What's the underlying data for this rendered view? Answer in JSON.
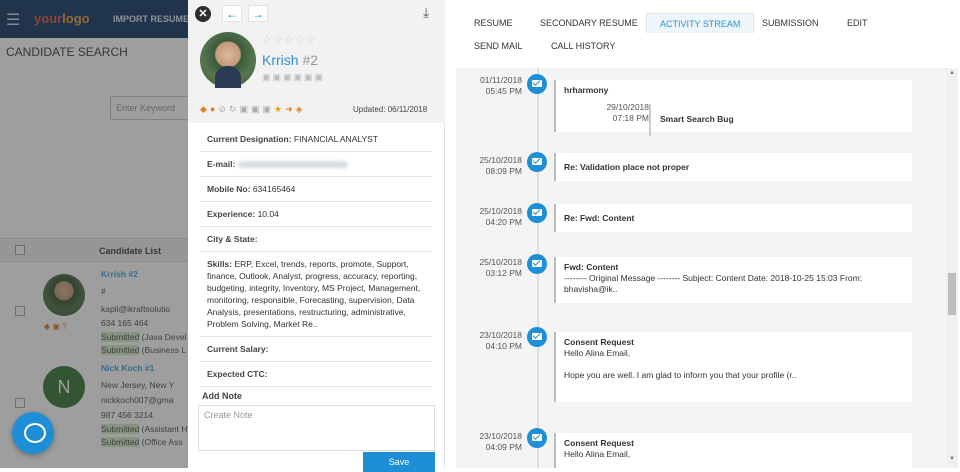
{
  "background": {
    "logo": {
      "part1": "your",
      "part2": "logo"
    },
    "import_resume": "IMPORT RESUME",
    "page_title": "CANDIDATE SEARCH",
    "keyword_placeholder": "Enter Keyword",
    "list_header": "Candidate List",
    "candidates": [
      {
        "name": "Krrish #2",
        "line2": "#",
        "email": "kapil@ikraftsolutio",
        "phone": "634 165 464",
        "status1": "Submitted",
        "status1_rest": " (Java Devel",
        "status2": "Submitted",
        "status2_rest": " (Business L"
      },
      {
        "name": "Nick Koch #1",
        "initial": "N",
        "address": "New Jersey, New Y",
        "email": "nickkoch007@gma",
        "phone": "987 456 3214",
        "status1": "Submitted",
        "status1_rest": " (Assistant H",
        "status2": "Submitted",
        "status2_rest": " (Office Ass"
      }
    ]
  },
  "profile": {
    "name": "Krrish",
    "number": "#2",
    "rating_stars": "☆☆☆☆☆",
    "updated_label": "Updated:",
    "updated_date": "06/11/2018",
    "fields": {
      "designation_label": "Current Designation:",
      "designation_value": "FINANCIAL ANALYST",
      "email_label": "E-mail:",
      "mobile_label": "Mobile No:",
      "mobile_value": "634165464",
      "experience_label": "Experience:",
      "experience_value": "10.04",
      "city_label": "City & State:",
      "skills_label": "Skills:",
      "skills_value": "ERP, Excel, trends, reports, promote, Support, finance, Outlook, Analyst, progress, accuracy, reporting, budgeting, integrity, Inventory, MS Project, Management, monitoring, responsible, Forecasting, supervision, Data Analysis, presentations, restructuring, administrative, Problem Solving, Market Re..",
      "salary_label": "Current Salary:",
      "ctc_label": "Expected CTC:"
    },
    "add_note_label": "Add Note",
    "note_placeholder": "Create Note",
    "save_label": "Save"
  },
  "tabs": [
    "RESUME",
    "SECONDARY RESUME",
    "ACTIVITY STREAM",
    "SUBMISSION",
    "EDIT",
    "SEND MAIL",
    "CALL HISTORY"
  ],
  "active_tab": "ACTIVITY STREAM",
  "activity": [
    {
      "date": "01/11/2018",
      "time": "05:45 PM",
      "title": "hrharmony",
      "inner_date": "29/10/2018",
      "inner_time": "07:18 PM",
      "inner_title": "Smart Search Bug"
    },
    {
      "date": "25/10/2018",
      "time": "08:09 PM",
      "title": "Re: Validation place not proper"
    },
    {
      "date": "25/10/2018",
      "time": "04:20 PM",
      "title": "Re: Fwd: Content"
    },
    {
      "date": "25/10/2018",
      "time": "03:12 PM",
      "title": "Fwd: Content",
      "body": "-------- Original Message -------- Subject: Content Date: 2018-10-25 15:03 From: bhavisha@ik.."
    },
    {
      "date": "23/10/2018",
      "time": "04:10 PM",
      "title": "Consent Request",
      "body": "Hello Alina Email,",
      "body2": "Hope you are well. I am glad to inform you that your profile (r.."
    },
    {
      "date": "23/10/2018",
      "time": "04:09 PM",
      "title": "Consent Request",
      "body": "Hello Alina Email,"
    }
  ],
  "colors": {
    "accent": "#1e8fd6",
    "topbar": "#1b3f6b",
    "submitted_bg": "#d6efc8"
  }
}
